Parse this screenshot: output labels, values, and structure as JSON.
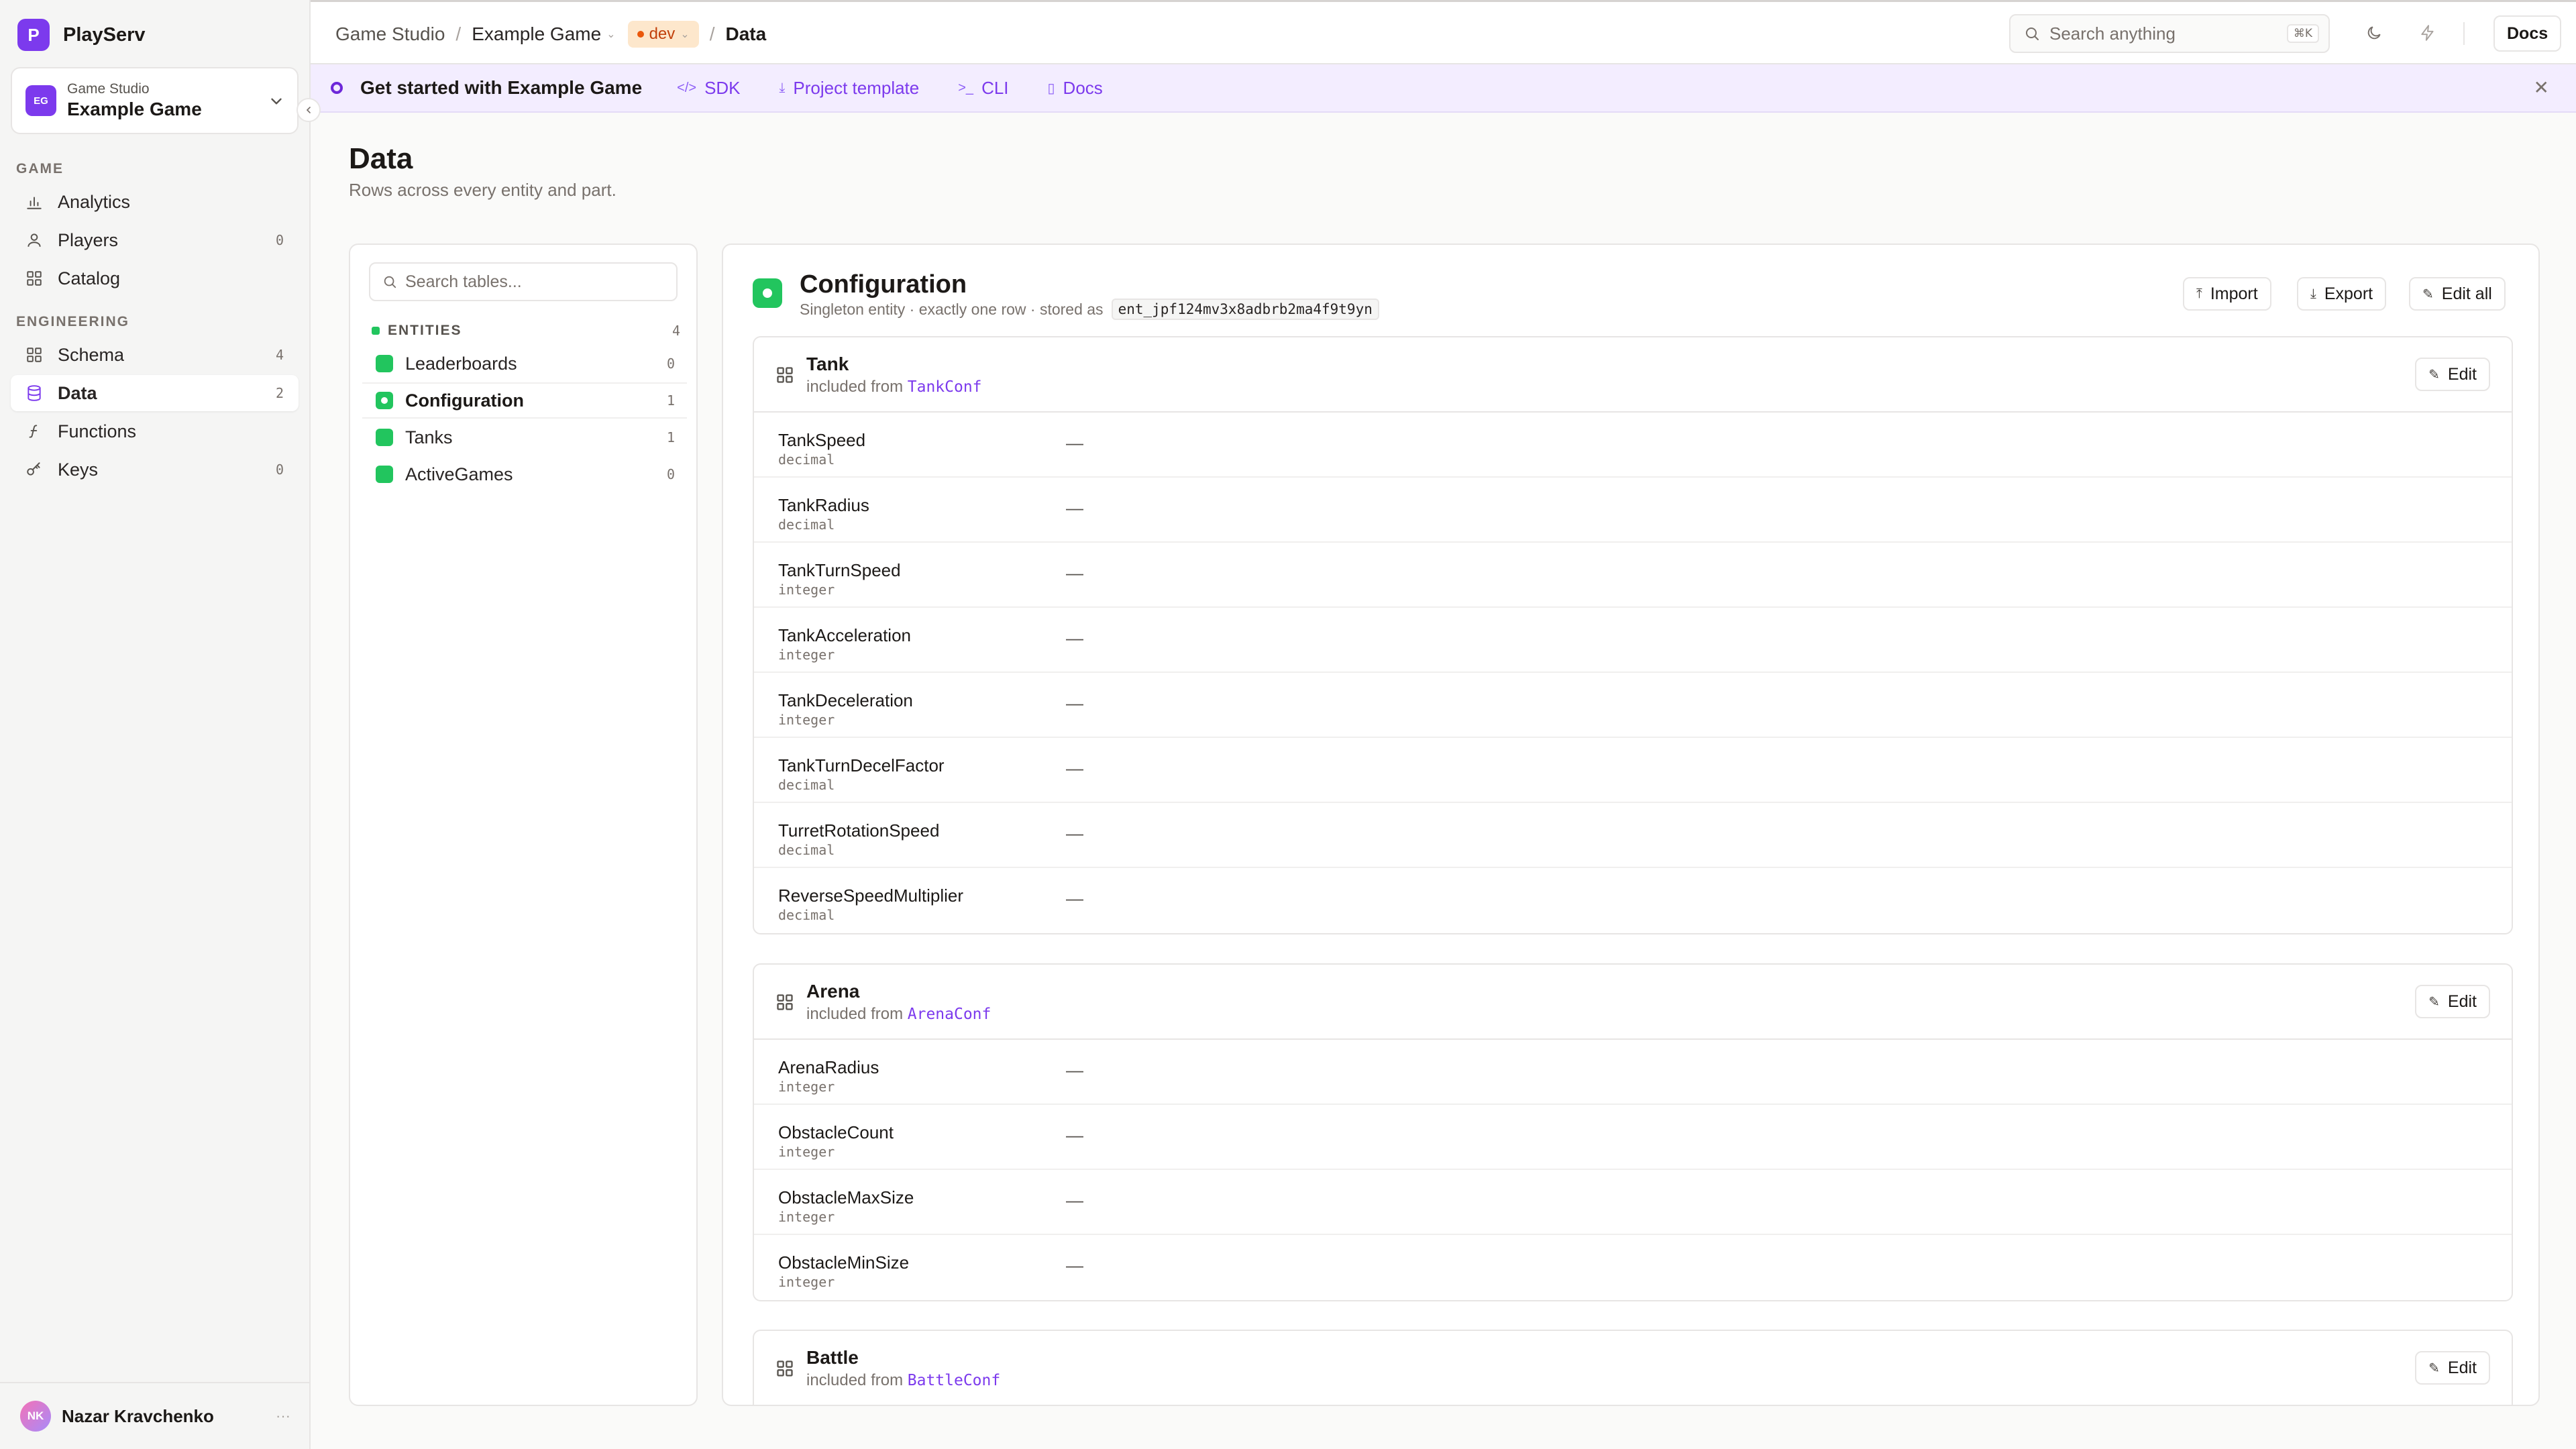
{
  "app": {
    "name": "PlayServ",
    "logo_letter": "P",
    "accent": "#7c3aed"
  },
  "project": {
    "org": "Game Studio",
    "name": "Example Game",
    "initials": "EG"
  },
  "nav": {
    "game_section": "GAME",
    "engineering_section": "ENGINEERING",
    "items": [
      {
        "label": "Analytics",
        "icon": "bar-chart-icon",
        "count": ""
      },
      {
        "label": "Players",
        "icon": "user-icon",
        "count": "0"
      },
      {
        "label": "Catalog",
        "icon": "grid-icon",
        "count": ""
      },
      {
        "label": "Schema",
        "icon": "schema-icon",
        "count": "4"
      },
      {
        "label": "Data",
        "icon": "database-icon",
        "count": "2",
        "active": true
      },
      {
        "label": "Functions",
        "icon": "function-icon",
        "count": ""
      },
      {
        "label": "Keys",
        "icon": "key-icon",
        "count": "0"
      }
    ]
  },
  "user": {
    "name": "Nazar Kravchenko",
    "initials": "NK",
    "more": "···"
  },
  "topbar": {
    "crumb_org": "Game Studio",
    "crumb_project": "Example Game",
    "crumb_env": "dev",
    "crumb_current": "Data",
    "sep": "/",
    "search_placeholder": "Search anything",
    "search_shortcut": "⌘K",
    "docs_label": "Docs"
  },
  "banner": {
    "title": "Get started with Example Game",
    "links": [
      {
        "label": "SDK",
        "glyph": "</>"
      },
      {
        "label": "Project template",
        "glyph": "⤓"
      },
      {
        "label": "CLI",
        "glyph": ">_"
      },
      {
        "label": "Docs",
        "glyph": "▯"
      }
    ],
    "close": "✕"
  },
  "page": {
    "title": "Data",
    "subtitle": "Rows across every entity and part."
  },
  "tables": {
    "search_placeholder": "Search tables...",
    "section_label": "ENTITIES",
    "section_count": "4",
    "entities": [
      {
        "name": "Leaderboards",
        "count": "0"
      },
      {
        "name": "Configuration",
        "count": "1",
        "active": true
      },
      {
        "name": "Tanks",
        "count": "1"
      },
      {
        "name": "ActiveGames",
        "count": "0"
      }
    ]
  },
  "detail": {
    "title": "Configuration",
    "subtitle": "Singleton entity · exactly one row · stored as",
    "storage_id": "ent_jpf124mv3x8adbrb2ma4f9t9yn",
    "import_label": "Import",
    "export_label": "Export",
    "edit_all_label": "Edit all",
    "edit_label": "Edit",
    "included_from": "included from",
    "empty_value": "—",
    "parts": [
      {
        "name": "Tank",
        "source": "TankConf",
        "fields": [
          {
            "name": "TankSpeed",
            "type": "decimal"
          },
          {
            "name": "TankRadius",
            "type": "decimal"
          },
          {
            "name": "TankTurnSpeed",
            "type": "integer"
          },
          {
            "name": "TankAcceleration",
            "type": "integer"
          },
          {
            "name": "TankDeceleration",
            "type": "integer"
          },
          {
            "name": "TankTurnDecelFactor",
            "type": "decimal"
          },
          {
            "name": "TurretRotationSpeed",
            "type": "decimal"
          },
          {
            "name": "ReverseSpeedMultiplier",
            "type": "decimal"
          }
        ]
      },
      {
        "name": "Arena",
        "source": "ArenaConf",
        "fields": [
          {
            "name": "ArenaRadius",
            "type": "integer"
          },
          {
            "name": "ObstacleCount",
            "type": "integer"
          },
          {
            "name": "ObstacleMaxSize",
            "type": "integer"
          },
          {
            "name": "ObstacleMinSize",
            "type": "integer"
          }
        ]
      },
      {
        "name": "Battle",
        "source": "BattleConf",
        "fields": []
      }
    ]
  }
}
